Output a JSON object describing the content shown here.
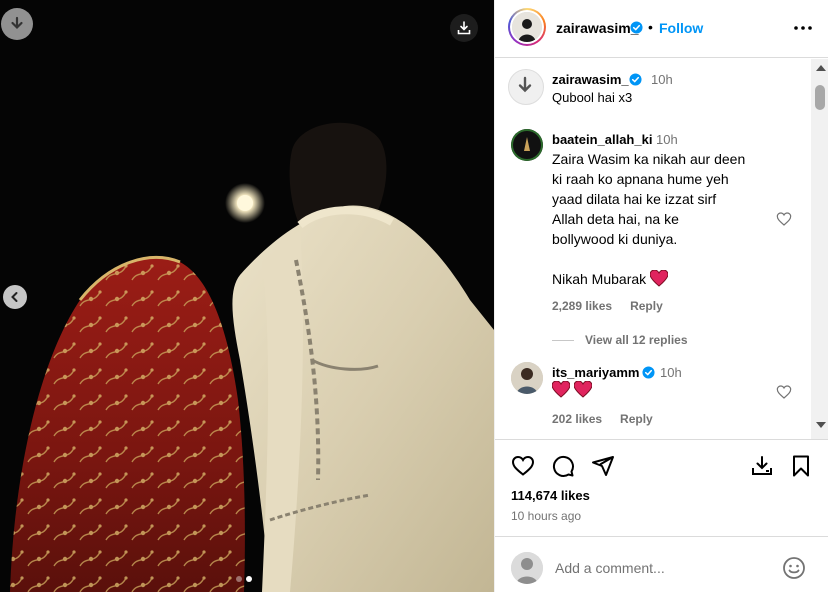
{
  "post": {
    "username": "zairawasim_",
    "follow_label": "Follow",
    "separator": "•",
    "likes": "114,674 likes",
    "time_ago": "10 hours ago",
    "caption": {
      "username": "zairawasim_",
      "time": "10h",
      "text": "Qubool hai x3"
    }
  },
  "comments": [
    {
      "username": "baatein_allah_ki",
      "time": "10h",
      "lines": [
        "Zaira Wasim ka nikah aur deen",
        "ki raah ko apnana hume yeh",
        "yaad dilata hai ke izzat sirf",
        "Allah deta hai, na ke",
        "bollywood ki duniya."
      ],
      "line2": "Nikah Mubarak",
      "likes": "2,289 likes",
      "reply_label": "Reply",
      "view_replies": "View all 12 replies"
    },
    {
      "username": "its_mariyamm",
      "time": "10h",
      "likes": "202 likes",
      "reply_label": "Reply"
    }
  ],
  "add_comment": {
    "placeholder": "Add a comment..."
  },
  "icons": {
    "verified": "verified-badge-icon",
    "more": "more-options-icon",
    "like": "heart-icon",
    "comment": "comment-icon",
    "share": "share-icon",
    "save": "save-icon",
    "download": "download-icon",
    "emoji": "emoji-icon"
  },
  "colors": {
    "accent": "#0095f6",
    "muted": "#737373",
    "heart_red": "#e0245e"
  },
  "carousel": {
    "slides": 2,
    "active_index": 1
  }
}
